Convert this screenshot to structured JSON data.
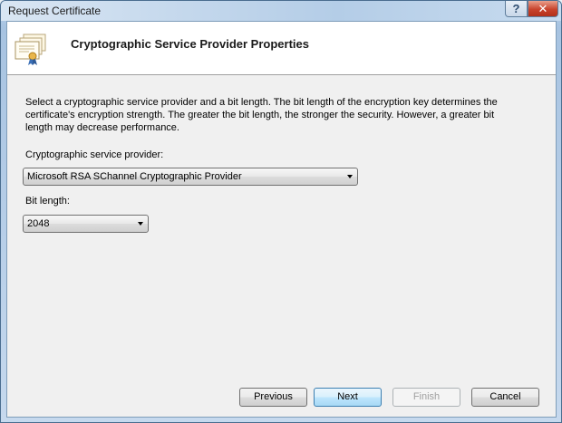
{
  "window": {
    "title": "Request Certificate",
    "help_label": "?",
    "close_label": "✕"
  },
  "header": {
    "title": "Cryptographic Service Provider Properties",
    "icon": "certificate-icon"
  },
  "description": "Select a cryptographic service provider and a bit length.  The bit length of the encryption key determines the certificate's encryption strength. The greater the bit length, the stronger the security. However, a greater bit length may decrease performance.",
  "csp": {
    "label": "Cryptographic service provider:",
    "value": "Microsoft RSA SChannel Cryptographic Provider"
  },
  "bitlength": {
    "label": "Bit length:",
    "value": "2048"
  },
  "buttons": {
    "previous": "Previous",
    "next": "Next",
    "finish": "Finish",
    "cancel": "Cancel"
  }
}
